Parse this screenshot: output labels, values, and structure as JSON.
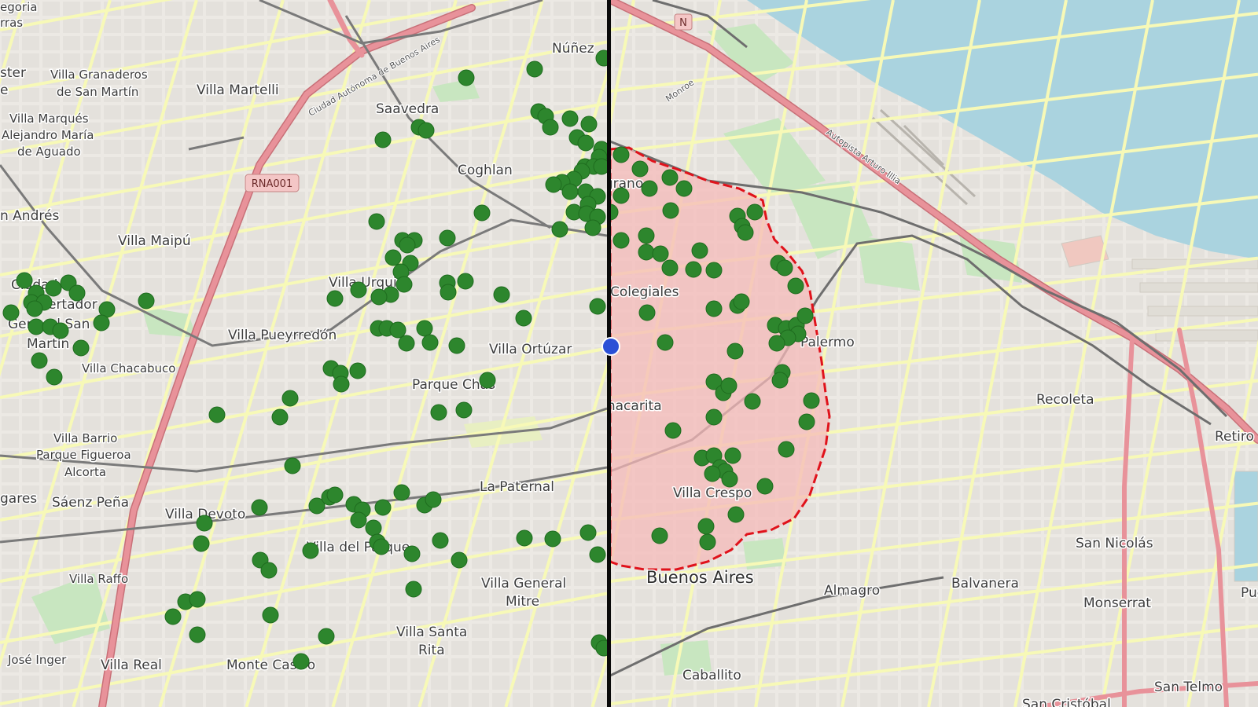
{
  "map": {
    "colors": {
      "land": "#f2efe9",
      "water": "#aad3df",
      "park": "#c8e6c0",
      "road_major": "#e8929a",
      "road_secondary": "#f7f9b7",
      "rail": "#707070",
      "marker": "#2d862d",
      "marker_stroke": "#1e6b1e",
      "polygon_fill": "#f6b9b9",
      "polygon_stroke": "#e0121b",
      "divider": "#0a0a0a",
      "current_location": "#2b50d6"
    },
    "left_panel": {
      "labels": [
        "egoria",
        "rras",
        "ster",
        "e",
        "Villa Granaderos",
        "de San Martín",
        "Villa Martelli",
        "Núñez",
        "Saavedra",
        "Villa Marqués",
        "Alejandro María",
        "de Aguado",
        "Coghlan",
        "n Andrés",
        "Villa Maipú",
        "Ciudad",
        "Libertador",
        "General San",
        "Martín",
        "Villa Urquiza",
        "Villa Pueyrredón",
        "Villa Chacabuco",
        "Villa Ortúzar",
        "Parque Chas",
        "Villa Barrio",
        "Parque Figueroa",
        "Alcorta",
        "gares",
        "Sáenz Peña",
        "Villa Devoto",
        "La Paternal",
        "Villa del Parque",
        "Villa General",
        "Mitre",
        "Villa Raffo",
        "Villa Santa",
        "Rita",
        "José Inger",
        "Villa Real",
        "Monte Castro"
      ],
      "road_labels": [
        "Ciudad Autónoma de Buenos Aires"
      ],
      "shield": "RNA001"
    },
    "right_panel": {
      "labels": [
        "Belgrano",
        "Colegiales",
        "Palermo",
        "Chacarita",
        "Villa Crespo",
        "Buenos Aires",
        "Almagro",
        "Balvanera",
        "Recoleta",
        "Retiro",
        "San Nicolás",
        "Monserrat",
        "Puerto",
        "Caballito",
        "San Telmo",
        "San Cristóbal"
      ],
      "road_labels": [
        "Autopista Arturo Illia",
        "Monroe"
      ],
      "shield": "N"
    }
  }
}
